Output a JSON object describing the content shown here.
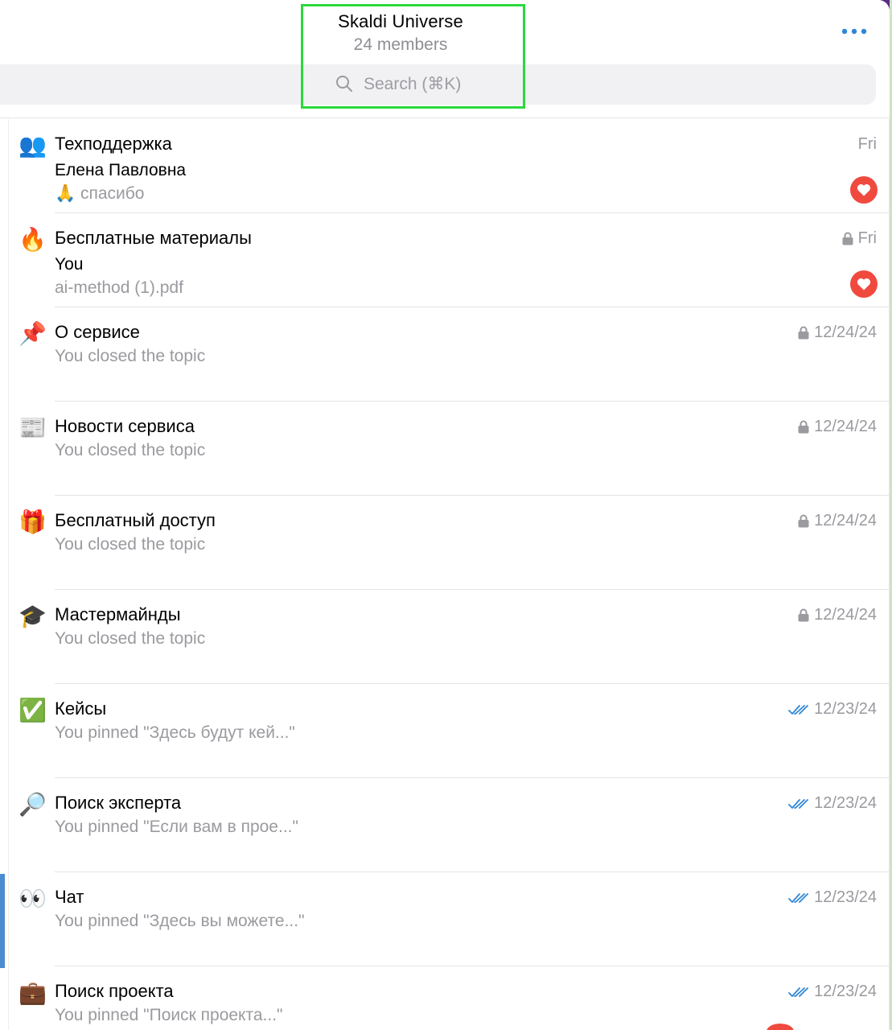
{
  "header": {
    "title": "Skaldi Universe",
    "members": "24 members"
  },
  "search": {
    "placeholder": "Search (⌘K)"
  },
  "colors": {
    "accent": "#2f86d6",
    "badge_red": "#f04a3f",
    "muted_text": "#9a9a9f",
    "highlight_box": "#2bd93c"
  },
  "topics": [
    {
      "icon": "people-icon",
      "emoji": "👥",
      "name": "Техподдержка",
      "sender": "Елена Павловна",
      "preview": "🙏 спасибо",
      "time": "Fri",
      "status": "none",
      "reaction": "heart"
    },
    {
      "icon": "fire-icon",
      "emoji": "🔥",
      "name": "Бесплатные материалы",
      "sender": "You",
      "preview": "ai-method (1).pdf",
      "time": "Fri",
      "status": "locked",
      "reaction": "heart"
    },
    {
      "icon": "pushpin-icon",
      "emoji": "📌",
      "name": "О сервисе",
      "preview": "You closed the topic",
      "time": "12/24/24",
      "status": "locked"
    },
    {
      "icon": "newspaper-icon",
      "emoji": "📰",
      "name": "Новости сервиса",
      "preview": "You closed the topic",
      "time": "12/24/24",
      "status": "locked"
    },
    {
      "icon": "gift-icon",
      "emoji": "🎁",
      "name": "Бесплатный доступ",
      "preview": "You closed the topic",
      "time": "12/24/24",
      "status": "locked"
    },
    {
      "icon": "graduation-cap-icon",
      "emoji": "🎓",
      "name": "Мастермайнды",
      "preview": "You closed the topic",
      "time": "12/24/24",
      "status": "locked"
    },
    {
      "icon": "check-mark-icon",
      "emoji": "✅",
      "name": "Кейсы",
      "preview": "You pinned \"Здесь будут кей...\"",
      "time": "12/23/24",
      "status": "read"
    },
    {
      "icon": "magnifier-icon",
      "emoji": "🔎",
      "name": "Поиск эксперта",
      "preview": "You pinned \"Если вам в прое...\"",
      "time": "12/23/24",
      "status": "read"
    },
    {
      "icon": "eyes-icon",
      "emoji": "👀",
      "name": "Чат",
      "preview": "You pinned \"Здесь вы можете...\"",
      "time": "12/23/24",
      "status": "read"
    },
    {
      "icon": "briefcase-icon",
      "emoji": "💼",
      "name": "Поиск проекта",
      "preview": "You pinned \"Поиск проекта...\"",
      "time": "12/23/24",
      "status": "read"
    }
  ]
}
